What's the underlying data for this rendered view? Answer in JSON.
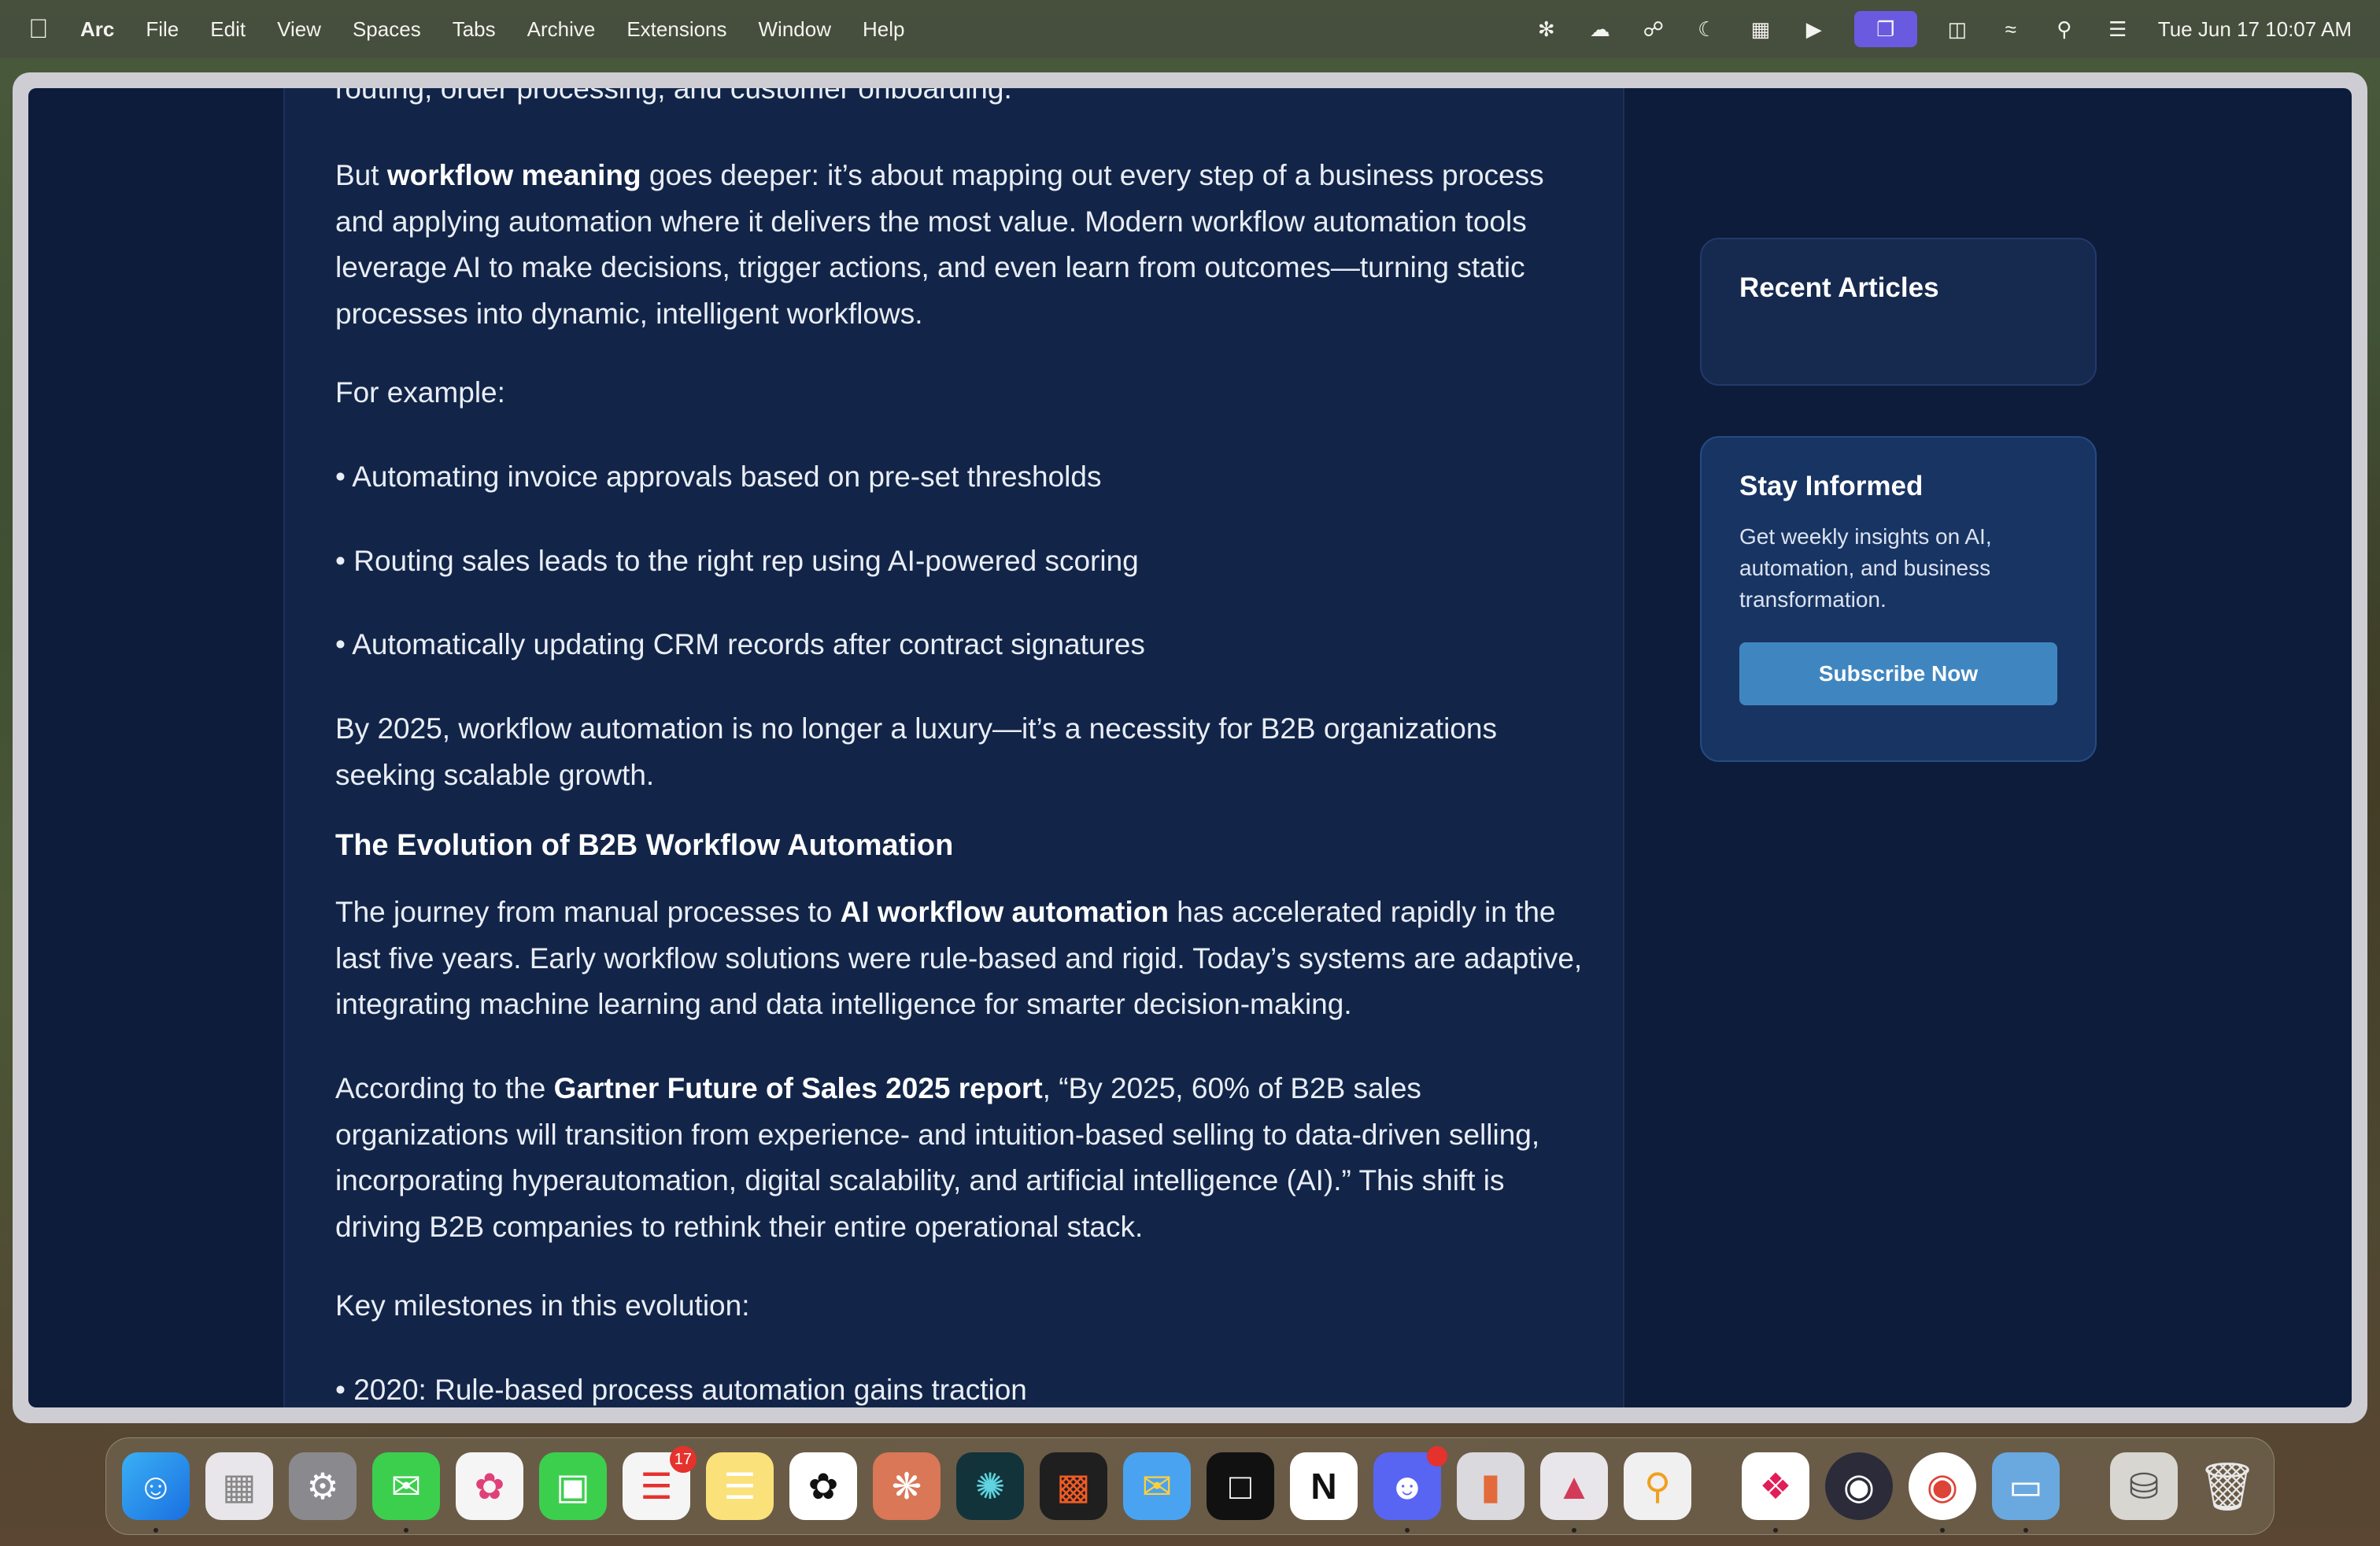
{
  "menubar": {
    "app_name": "Arc",
    "items": [
      "File",
      "Edit",
      "View",
      "Spaces",
      "Tabs",
      "Archive",
      "Extensions",
      "Window",
      "Help"
    ],
    "status_icons": [
      "perplexity-icon",
      "cloud-icon",
      "vpn-icon",
      "moon-icon",
      "grid-icon",
      "play-icon",
      "screen-mirror-icon",
      "battery-icon",
      "wifi-icon",
      "search-icon",
      "control-center-icon"
    ],
    "clock": "Tue Jun 17  10:07 AM"
  },
  "article": {
    "cut_line": "routing, order processing, and customer onboarding.",
    "p1_before": "But ",
    "p1_bold": "workflow meaning",
    "p1_after": " goes deeper: it’s about mapping out every step of a business process and applying automation where it delivers the most value. Modern workflow automation tools leverage AI to make decisions, trigger actions, and even learn from outcomes—turning static processes into dynamic, intelligent workflows.",
    "p2": "For example:",
    "bullets": [
      "• Automating invoice approvals based on pre-set thresholds",
      "• Routing sales leads to the right rep using AI-powered scoring",
      "• Automatically updating CRM records after contract signatures"
    ],
    "p3": "By 2025, workflow automation is no longer a luxury—it’s a necessity for B2B organizations seeking scalable growth.",
    "heading": "The Evolution of B2B Workflow Automation",
    "p4_before": "The journey from manual processes to ",
    "p4_bold": "AI workflow automation",
    "p4_after": " has accelerated rapidly in the last five years. Early workflow solutions were rule-based and rigid. Today’s systems are adaptive, integrating machine learning and data intelligence for smarter decision-making.",
    "p5_before": "According to the ",
    "p5_bold": "Gartner Future of Sales 2025 report",
    "p5_after": ", “By 2025, 60% of B2B sales organizations will transition from experience- and intuition-based selling to data-driven selling, incorporating hyperautomation, digital scalability, and artificial intelligence (AI).” This shift is driving B2B companies to rethink their entire operational stack.",
    "p6": "Key milestones in this evolution:",
    "milestone": "• 2020: Rule-based process automation gains traction"
  },
  "sidebar": {
    "recent_title": "Recent Articles",
    "stay_title": "Stay Informed",
    "stay_text": "Get weekly insights on AI, automation, and business transformation.",
    "subscribe_label": "Subscribe Now"
  },
  "dock": {
    "apps": [
      "Finder",
      "Launchpad",
      "System Settings",
      "Messages",
      "Photos",
      "FaceTime",
      "Reminders",
      "Notes",
      "ChatGPT",
      "Claude",
      "Perplexity",
      "Tableplus",
      "Airmail",
      "Linear",
      "Notion",
      "Discord",
      "iPhone Mirroring",
      "Affinity",
      "Keychain",
      "Slack",
      "OBS",
      "Chrome",
      "Screens",
      "Downloads",
      "Trash"
    ],
    "reminders_badge": "17",
    "accent_color": "#3f86c0"
  }
}
